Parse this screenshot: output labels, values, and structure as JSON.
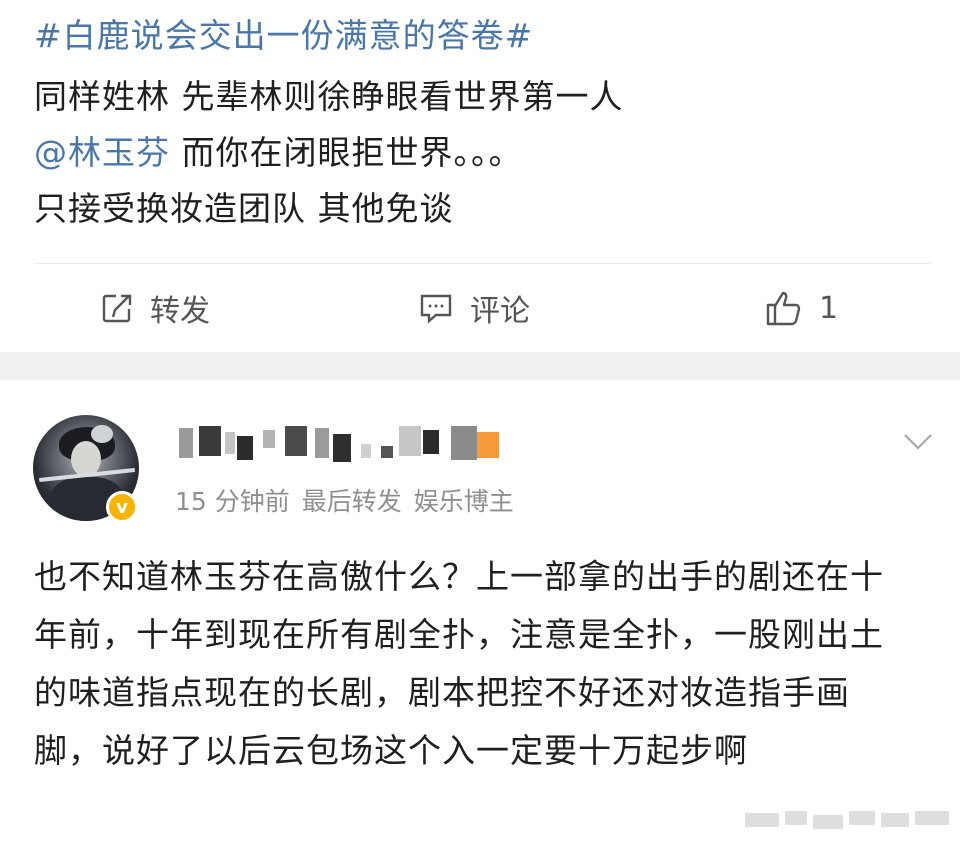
{
  "post1": {
    "topic": "#白鹿说会交出一份满意的答卷#",
    "line2": "同样姓林 先辈林则徐睁眼看世界第一人",
    "mention": "@林玉芬",
    "line3_rest": " 而你在闭眼拒世界。。。",
    "line4": "只接受换妆造团队 其他免谈",
    "actions": {
      "repost_label": "转发",
      "comment_label": "评论",
      "like_count": "1"
    }
  },
  "post2": {
    "meta": {
      "time": "15 分钟前",
      "status": "最后转发",
      "role": "娱乐博主"
    },
    "verified_mark": "v",
    "text": "也不知道林玉芬在高傲什么？上一部拿的出手的剧还在十年前，十年到现在所有剧全扑，注意是全扑，一股刚出土的味道指点现在的长剧，剧本把控不好还对妆造指手画脚，说好了以后云包场这个入一定要十万起步啊"
  },
  "icons": {
    "repost": "repost-icon",
    "comment": "comment-icon",
    "like": "thumbs-up-icon",
    "more": "chevron-down-icon"
  },
  "colors": {
    "link": "#4a76a8",
    "meta": "#8f8f8f",
    "separator": "#f1f1f1",
    "verified": "#f6b300"
  }
}
